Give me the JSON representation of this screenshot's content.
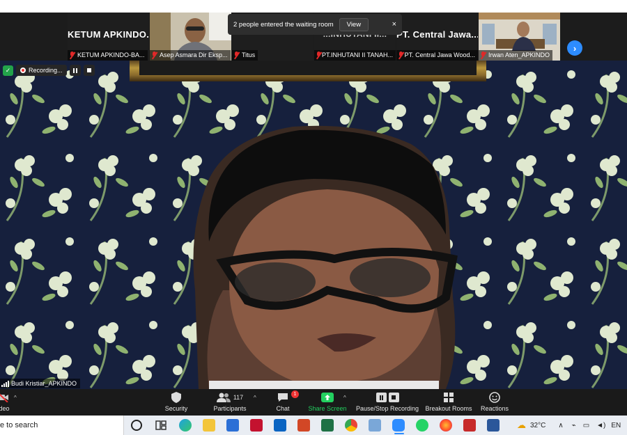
{
  "gallery": {
    "tiles": [
      {
        "big": "KETUM  APKINDO...",
        "label": "KETUM APKINDO-BA..."
      },
      {
        "big": "",
        "label": "Asep Asmara Dir Eksp..."
      },
      {
        "big": "",
        "label": "Titus"
      },
      {
        "big": "...INHUTANI II...",
        "label": "PT.INHUTANI II TANAH..."
      },
      {
        "big": "PT.  Central  Jawa...",
        "label": "PT. Central Jawa Wood..."
      },
      {
        "big": "",
        "label": "Irwan Aten_APKINDO"
      }
    ]
  },
  "notification": {
    "text": "2 people entered the waiting room",
    "view_label": "View",
    "close_glyph": "×"
  },
  "next_page_glyph": "›",
  "recording": {
    "label": "Recording..."
  },
  "speaker": {
    "name": "Budi Kristiar_APKINDO"
  },
  "toolbar": {
    "video_label": "ideo",
    "security_label": "Security",
    "participants_label": "Participants",
    "participants_count": "117",
    "chat_label": "Chat",
    "chat_badge": "1",
    "share_label": "Share Screen",
    "recording_label": "Pause/Stop Recording",
    "breakout_label": "Breakout Rooms",
    "reactions_label": "Reactions",
    "caret": "^"
  },
  "taskbar": {
    "search_placeholder": "e to search",
    "temperature": "32°C",
    "lang": "EN"
  },
  "colors": {
    "accent": "#2d8cff",
    "share_green": "#23d160",
    "mic_off_red": "#e02828",
    "recording_red": "#ee3333"
  }
}
